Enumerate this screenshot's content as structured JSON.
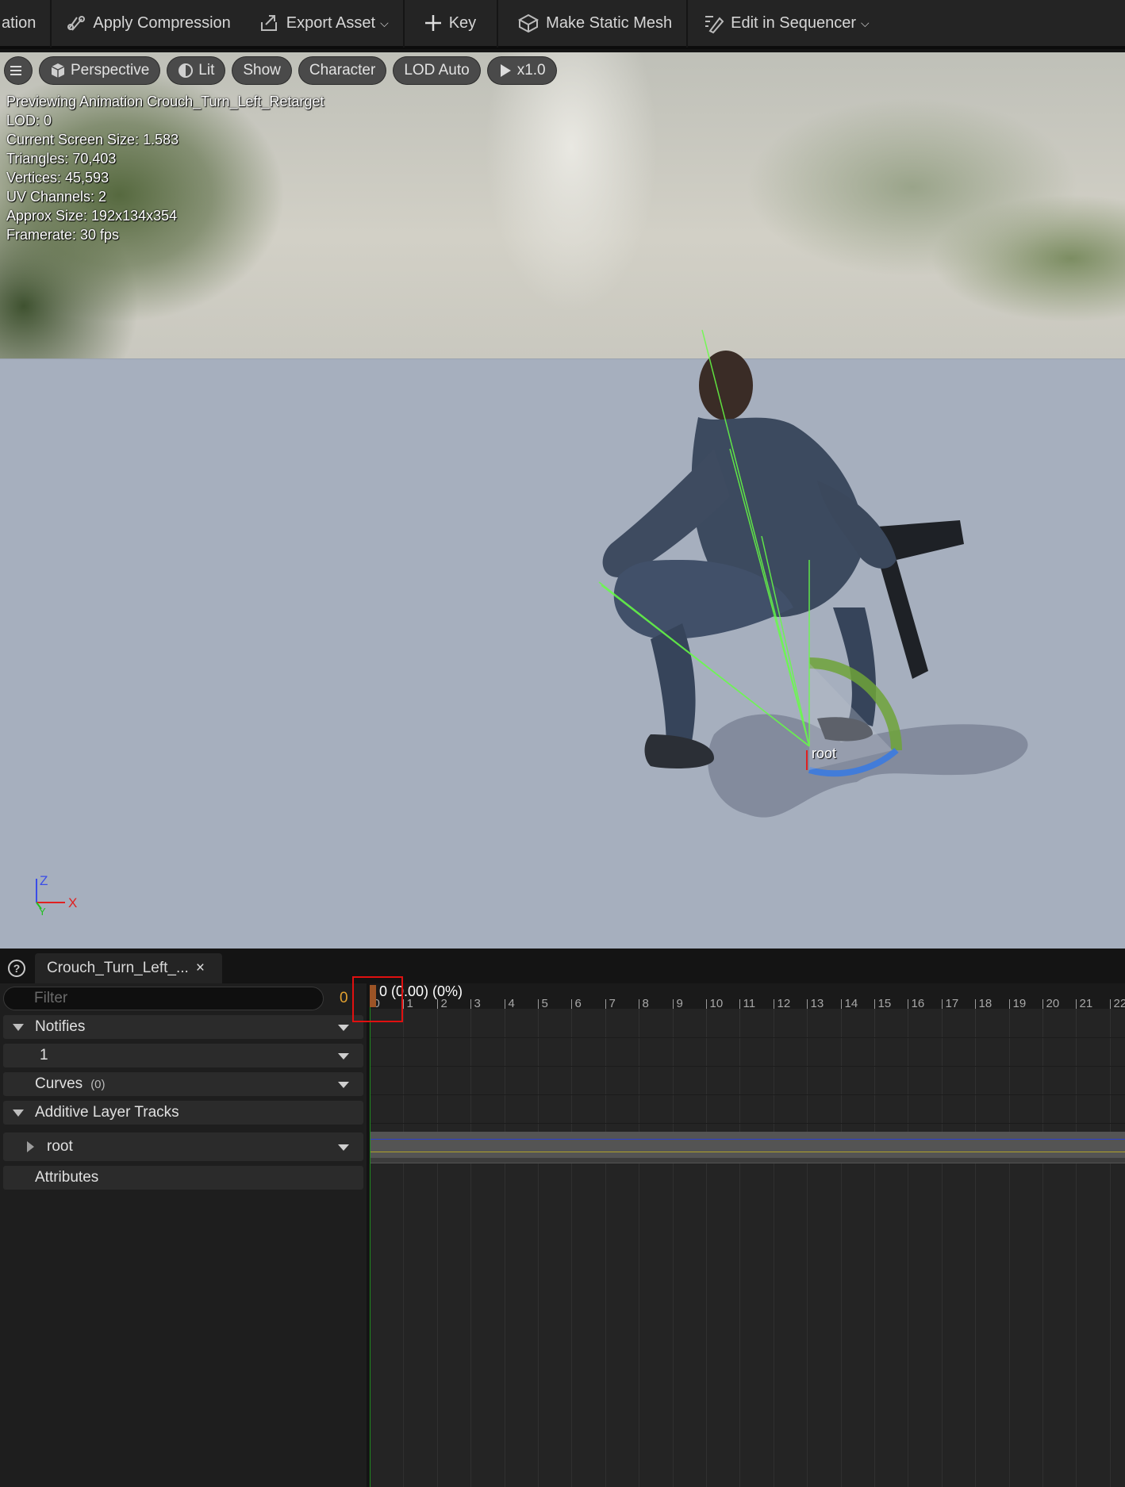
{
  "toolbar": {
    "items": [
      {
        "label": "ation",
        "icon": "none"
      },
      {
        "label": "Apply Compression",
        "icon": "compression-icon"
      },
      {
        "label": "Export Asset",
        "icon": "export-icon",
        "dropdown": true
      },
      {
        "label": "Key",
        "icon": "plus-icon"
      },
      {
        "label": "Make Static Mesh",
        "icon": "static-mesh-icon"
      },
      {
        "label": "Edit in Sequencer",
        "icon": "sequencer-icon",
        "dropdown": true
      }
    ]
  },
  "viewport": {
    "buttons": {
      "perspective": "Perspective",
      "lit": "Lit",
      "show": "Show",
      "character": "Character",
      "lod": "LOD Auto",
      "play_rate": "x1.0"
    },
    "stats": [
      "Previewing Animation Crouch_Turn_Left_Retarget",
      "LOD: 0",
      "Current Screen Size: 1.583",
      "Triangles: 70,403",
      "Vertices: 45,593",
      "UV Channels: 2",
      "Approx Size: 192x134x354",
      "Framerate: 30 fps"
    ],
    "bone_label": "root",
    "axis": {
      "z": "Z",
      "x": "X",
      "y": "Y"
    },
    "colors": {
      "axis_z": "#3a4de8",
      "axis_x": "#e02020",
      "axis_y": "#20c020",
      "bones": "#66ff44"
    }
  },
  "panel": {
    "tab_title": "Crouch_Turn_Left_...",
    "tab_close": "×",
    "help": "?",
    "filter_placeholder": "Filter",
    "current_frame": "0",
    "scrub_info": "0 (0.00) (0%)",
    "tracks": {
      "notifies": "Notifies",
      "notify_track": "1",
      "curves": "Curves",
      "curves_count": "(0)",
      "additive": "Additive Layer Tracks",
      "root": "root",
      "attributes": "Attributes"
    },
    "ruler_ticks": [
      "0",
      "1",
      "2",
      "3",
      "4",
      "5",
      "6",
      "7",
      "8",
      "9",
      "10",
      "11",
      "12",
      "13",
      "14",
      "15",
      "16",
      "17",
      "18",
      "19",
      "20",
      "21",
      "22"
    ]
  }
}
